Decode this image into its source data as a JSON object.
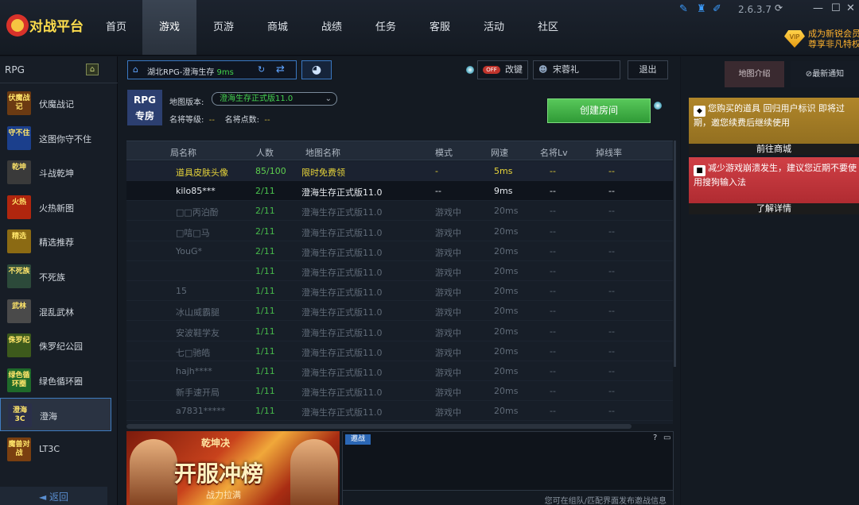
{
  "app": {
    "logo": "对战平台",
    "version": "2.6.3.7",
    "vip_line1": "成为新锐会员",
    "vip_line2": "尊享非凡特权",
    "vip_badge": "VIP"
  },
  "nav": [
    "首页",
    "游戏",
    "页游",
    "商城",
    "战绩",
    "任务",
    "客服",
    "活动",
    "社区"
  ],
  "sidebar": {
    "category": "RPG",
    "back": "返回",
    "games": [
      {
        "name": "伏魔战记",
        "thumb": "伏魔战记",
        "color": "#6b3a12"
      },
      {
        "name": "这图你守不住",
        "thumb": "守不住",
        "color": "#1b3f8c"
      },
      {
        "name": "斗战乾坤",
        "thumb": "乾坤",
        "color": "#3a3a3a"
      },
      {
        "name": "火热新图",
        "thumb": "火热",
        "color": "#b0260e"
      },
      {
        "name": "精选推荐",
        "thumb": "精选",
        "color": "#8b6a13"
      },
      {
        "name": "不死族",
        "thumb": "不死族",
        "color": "#2c4a3a"
      },
      {
        "name": "混乱武林",
        "thumb": "武林",
        "color": "#4a4a4a"
      },
      {
        "name": "侏罗纪公园",
        "thumb": "侏罗纪",
        "color": "#3d5a1c"
      },
      {
        "name": "绿色循环圈",
        "thumb": "绿色循环圈",
        "color": "#1f6a2a"
      },
      {
        "name": "澄海",
        "thumb": "澄海3C",
        "color": "#2a2f4a"
      },
      {
        "name": "LT3C",
        "thumb": "魔兽对战",
        "color": "#7a3f10"
      }
    ]
  },
  "toolbar": {
    "server": "湖北RPG-澄海生存",
    "ping": "9ms",
    "switch_label": "改键",
    "switch_state": "OFF",
    "user": "宋蓉礼",
    "logout": "退出"
  },
  "map": {
    "logo1": "RPG",
    "logo2": "专房",
    "version_label": "地图版本:",
    "version": "澄海生存正式版11.0",
    "level_label": "名将等级:",
    "level": "--",
    "points_label": "名将点数:",
    "points": "--",
    "create": "创建房间"
  },
  "table": {
    "headers": [
      "局名称",
      "人数",
      "地图名称",
      "模式",
      "网速",
      "名将Lv",
      "掉线率"
    ],
    "rows": [
      [
        "道具皮肤头像",
        "85/100",
        "限时免费领",
        "-",
        "5ms",
        "--",
        "--"
      ],
      [
        "kilo85***",
        "2/11",
        "澄海生存正式版11.0",
        "--",
        "9ms",
        "--",
        "--"
      ],
      [
        "□□丙泊酚",
        "2/11",
        "澄海生存正式版11.0",
        "游戏中",
        "20ms",
        "--",
        "--"
      ],
      [
        "□唁□马",
        "2/11",
        "澄海生存正式版11.0",
        "游戏中",
        "20ms",
        "--",
        "--"
      ],
      [
        "YouG*",
        "2/11",
        "澄海生存正式版11.0",
        "游戏中",
        "20ms",
        "--",
        "--"
      ],
      [
        "",
        "1/11",
        "澄海生存正式版11.0",
        "游戏中",
        "20ms",
        "--",
        "--"
      ],
      [
        "15",
        "1/11",
        "澄海生存正式版11.0",
        "游戏中",
        "20ms",
        "--",
        "--"
      ],
      [
        "冰山威霸腿",
        "1/11",
        "澄海生存正式版11.0",
        "游戏中",
        "20ms",
        "--",
        "--"
      ],
      [
        "安波鞋学友",
        "1/11",
        "澄海生存正式版11.0",
        "游戏中",
        "20ms",
        "--",
        "--"
      ],
      [
        "七□驰皓",
        "1/11",
        "澄海生存正式版11.0",
        "游戏中",
        "20ms",
        "--",
        "--"
      ],
      [
        "hajh****",
        "1/11",
        "澄海生存正式版11.0",
        "游戏中",
        "20ms",
        "--",
        "--"
      ],
      [
        "新手速开局",
        "1/11",
        "澄海生存正式版11.0",
        "游戏中",
        "20ms",
        "--",
        "--"
      ],
      [
        "a7831*****",
        "1/11",
        "澄海生存正式版11.0",
        "游戏中",
        "20ms",
        "--",
        "--"
      ]
    ]
  },
  "banner": {
    "top": "乾坤决",
    "main": "开服冲榜",
    "sub": "战力拉满"
  },
  "chat": {
    "tab": "邀战",
    "help": "?",
    "placeholder": "您可在组队/匹配界面发布邀战信息"
  },
  "right": {
    "tab1": "地图介绍",
    "tab2": "最新通知",
    "card1": {
      "text": "您购买的道具 回归用户标识 即将过期，邀您续费后继续使用",
      "link": "前往商城"
    },
    "card2": {
      "text": "减少游戏崩溃发生，建议您近期不要使用搜狗输入法",
      "link": "了解详情"
    }
  }
}
